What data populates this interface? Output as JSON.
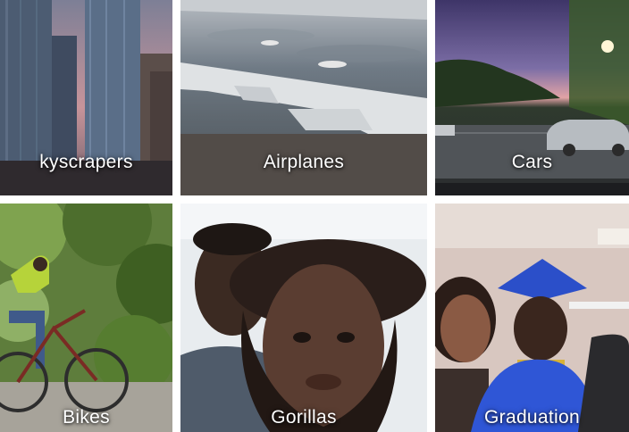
{
  "tiles": [
    {
      "label": "kyscrapers"
    },
    {
      "label": "Airplanes"
    },
    {
      "label": "Cars"
    },
    {
      "label": "Bikes"
    },
    {
      "label": "Gorillas"
    },
    {
      "label": "Graduation"
    }
  ],
  "colors": {
    "background": "#ffffff",
    "label_text": "#ffffff"
  }
}
